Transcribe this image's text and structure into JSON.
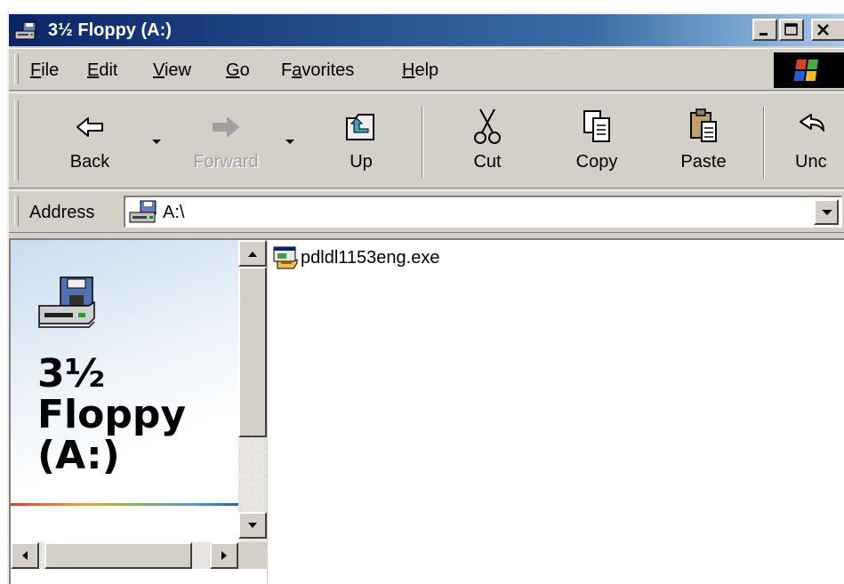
{
  "window": {
    "title": "3½ Floppy (A:)",
    "title_icon": "floppy-drive-icon",
    "controls": [
      "minimize",
      "maximize",
      "close"
    ]
  },
  "menu": {
    "items": [
      {
        "accel": "F",
        "rest": "ile"
      },
      {
        "accel": "E",
        "rest": "dit"
      },
      {
        "accel": "V",
        "rest": "iew"
      },
      {
        "accel": "G",
        "rest": "o"
      },
      {
        "pre": "F",
        "accel": "a",
        "rest": "vorites"
      },
      {
        "accel": "H",
        "rest": "elp"
      }
    ]
  },
  "toolbar": {
    "back": "Back",
    "forward": "Forward",
    "up": "Up",
    "cut": "Cut",
    "copy": "Copy",
    "paste": "Paste",
    "undo": "Unc"
  },
  "address": {
    "label": "Address",
    "value": "A:\\"
  },
  "webview": {
    "line1": "3½",
    "line2": "Floppy",
    "line3": "(A:)"
  },
  "files": [
    {
      "name": "pdldl1153eng.exe",
      "icon": "installer-exe-icon"
    }
  ],
  "colors": {
    "titlebar_start": "#0a246a",
    "titlebar_end": "#a6caf0",
    "face": "#d4d0c8"
  }
}
